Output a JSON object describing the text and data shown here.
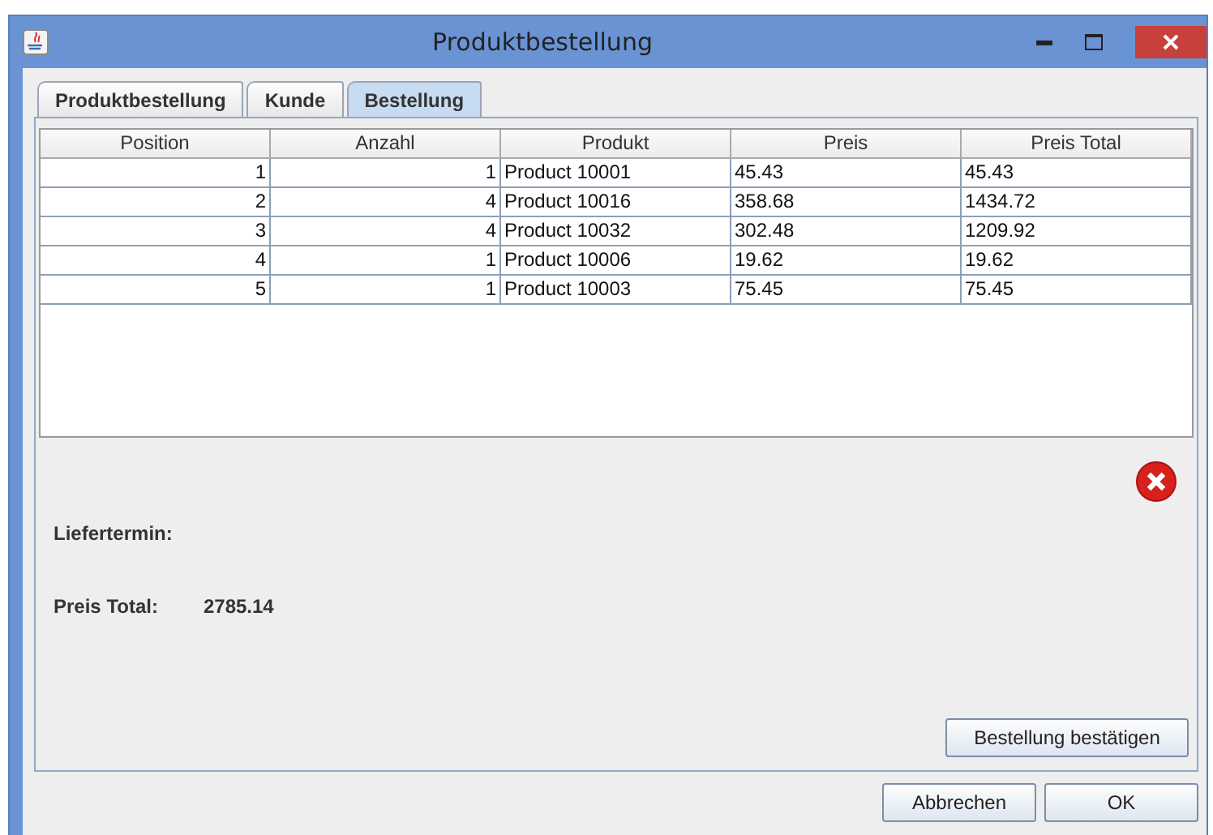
{
  "window": {
    "title": "Produktbestellung"
  },
  "tabs": [
    {
      "label": "Produktbestellung",
      "selected": false
    },
    {
      "label": "Kunde",
      "selected": false
    },
    {
      "label": "Bestellung",
      "selected": true
    }
  ],
  "table": {
    "columns": [
      {
        "label": "Position",
        "kind": "number"
      },
      {
        "label": "Anzahl",
        "kind": "number"
      },
      {
        "label": "Produkt",
        "kind": "text"
      },
      {
        "label": "Preis",
        "kind": "text"
      },
      {
        "label": "Preis Total",
        "kind": "text"
      }
    ],
    "rows": [
      [
        "1",
        "1",
        "Product 10001",
        "45.43",
        "45.43"
      ],
      [
        "2",
        "4",
        "Product 10016",
        "358.68",
        "1434.72"
      ],
      [
        "3",
        "4",
        "Product 10032",
        "302.48",
        "1209.92"
      ],
      [
        "4",
        "1",
        "Product 10006",
        "19.62",
        "19.62"
      ],
      [
        "5",
        "1",
        "Product 10003",
        "75.45",
        "75.45"
      ]
    ]
  },
  "fields": [
    {
      "label": "Liefertermin:"
    },
    {
      "label": "Preis Total:",
      "value": "2785.14"
    }
  ],
  "confirm_button": "Bestellung bestätigen",
  "buttons": [
    "Abbrechen",
    "OK"
  ]
}
